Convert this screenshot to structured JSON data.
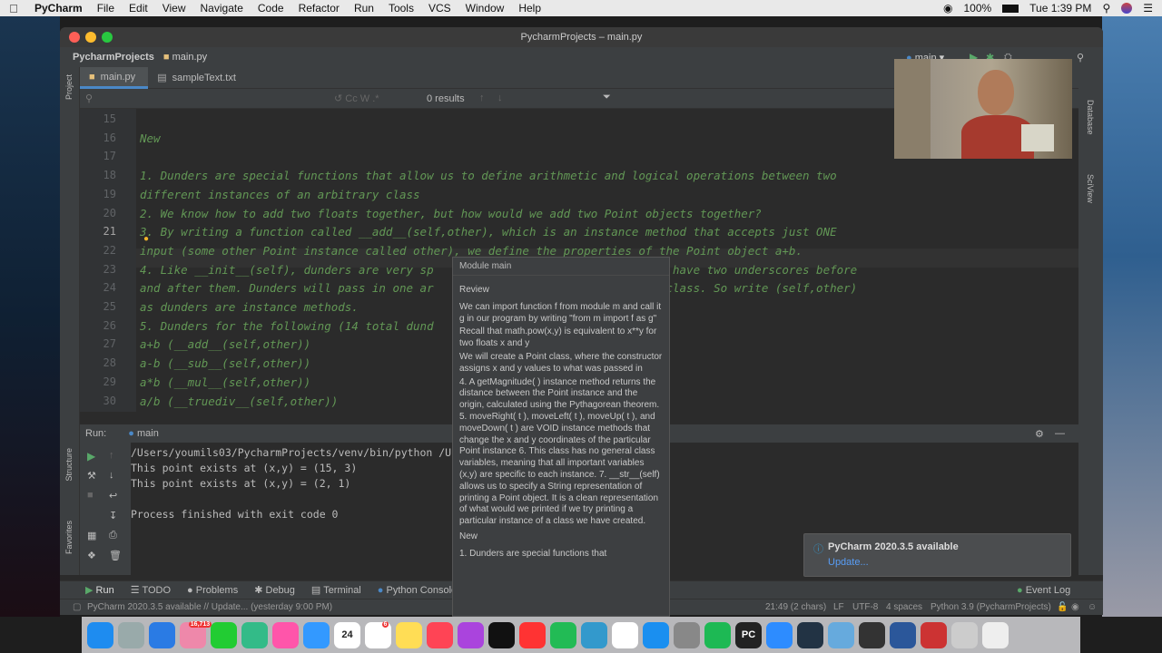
{
  "menubar": {
    "apple_icon": "apple-icon",
    "app": "PyCharm",
    "items": [
      "File",
      "Edit",
      "View",
      "Navigate",
      "Code",
      "Refactor",
      "Run",
      "Tools",
      "VCS",
      "Window",
      "Help"
    ],
    "battery": "100%",
    "time": "Tue 1:39 PM"
  },
  "window": {
    "title": "PycharmProjects – main.py"
  },
  "navbar": {
    "project": "PycharmProjects",
    "file": "main.py",
    "run_config": "main"
  },
  "tabs": [
    {
      "label": "main.py"
    },
    {
      "label": "sampleText.txt"
    }
  ],
  "search": {
    "results": "0 results"
  },
  "side_labels": {
    "project": "Project",
    "structure": "Structure",
    "favorites": "Favorites",
    "database": "Database",
    "sciview": "SciView"
  },
  "editor": {
    "lines": [
      {
        "n": "15",
        "t": ""
      },
      {
        "n": "16",
        "t": "New"
      },
      {
        "n": "17",
        "t": ""
      },
      {
        "n": "18",
        "t": "1. Dunders are special functions that allow us to define arithmetic and logical operations between two"
      },
      {
        "n": "19",
        "t": "different instances of an arbitrary class"
      },
      {
        "n": "20",
        "t": "2. We know how to add two floats together, but how would we add two Point objects together?"
      },
      {
        "n": "21",
        "t": "3. By writing a function called __add__(self,other), which is an instance method that accepts just ONE"
      },
      {
        "n": "22",
        "t": "input (some other Point instance called other), we define the properties of the Point object a+b."
      },
      {
        "n": "23",
        "t": "4. Like __init__(self), dunders are very sp                              must have two underscores before"
      },
      {
        "n": "24",
        "t": "and after them. Dunders will pass in one ar                              the class. So write (self,other)"
      },
      {
        "n": "25",
        "t": "as dunders are instance methods."
      },
      {
        "n": "26",
        "t": "5. Dunders for the following (14 total dund"
      },
      {
        "n": "27",
        "t": "a+b (__add__(self,other))"
      },
      {
        "n": "28",
        "t": "a-b (__sub__(self,other))"
      },
      {
        "n": "29",
        "t": "a*b (__mul__(self,other))"
      },
      {
        "n": "30",
        "t": "a/b (__truediv__(self,other))"
      }
    ]
  },
  "run": {
    "label": "Run:",
    "config": "main",
    "lines": [
      "/Users/youmils03/PycharmProjects/venv/bin/python /Users",
      "This point exists at (x,y) = (15, 3)",
      "This point exists at (x,y) = (2, 1)",
      "",
      "Process finished with exit code 0"
    ]
  },
  "popup": {
    "header": "Module main",
    "paragraphs": [
      "Review",
      "We can import function f from module m and call it g in our program by writing \"from m import f as g\"",
      "Recall that math.pow(x,y) is equivalent to x**y for two floats x and y",
      "We will create a Point class, where the constructor assigns x and y values to what was passed in",
      "4. A getMagnitude( ) instance method returns the distance between the Point instance and the origin, calculated using the Pythagorean theorem. 5. moveRight( t ), moveLeft( t ), moveUp( t ), and moveDown( t ) are VOID instance methods that change the x and y coordinates of the particular Point instance 6. This class has no general class variables, meaning that all important variables (x,y) are specific to each instance. 7. __str__(self) allows us to specify a String representation of printing a Point object. It is a clean representation of what would we printed if we try printing a particular instance of a class we have created.",
      "New",
      "1. Dunders are special functions that"
    ]
  },
  "bottom_tabs": [
    "Run",
    "TODO",
    "Problems",
    "Debug",
    "Terminal",
    "Python Console"
  ],
  "event_log": "Event Log",
  "notification": {
    "title": "PyCharm 2020.3.5 available",
    "link": "Update..."
  },
  "status": {
    "message": "PyCharm 2020.3.5 available // Update... (yesterday 9:00 PM)",
    "position": "21:49 (2 chars)",
    "line_sep": "LF",
    "encoding": "UTF-8",
    "indent": "4 spaces",
    "interpreter": "Python 3.9 (PycharmProjects)"
  },
  "dock": {
    "calendar_day": "24",
    "badge_1": "16,713",
    "badge_2": "6",
    "apps": [
      "finder",
      "launchpad",
      "safari",
      "photos-app",
      "facetime",
      "messages",
      "photos",
      "mail",
      "calendar",
      "reminders",
      "notes",
      "music",
      "podcasts",
      "tv",
      "news",
      "numbers",
      "keynote",
      "chrome",
      "app-store",
      "system-preferences",
      "spotify",
      "pycharm",
      "zoom",
      "quicktime",
      "preview",
      "terminal",
      "word",
      "acrobat",
      "downloads",
      "trash"
    ]
  }
}
